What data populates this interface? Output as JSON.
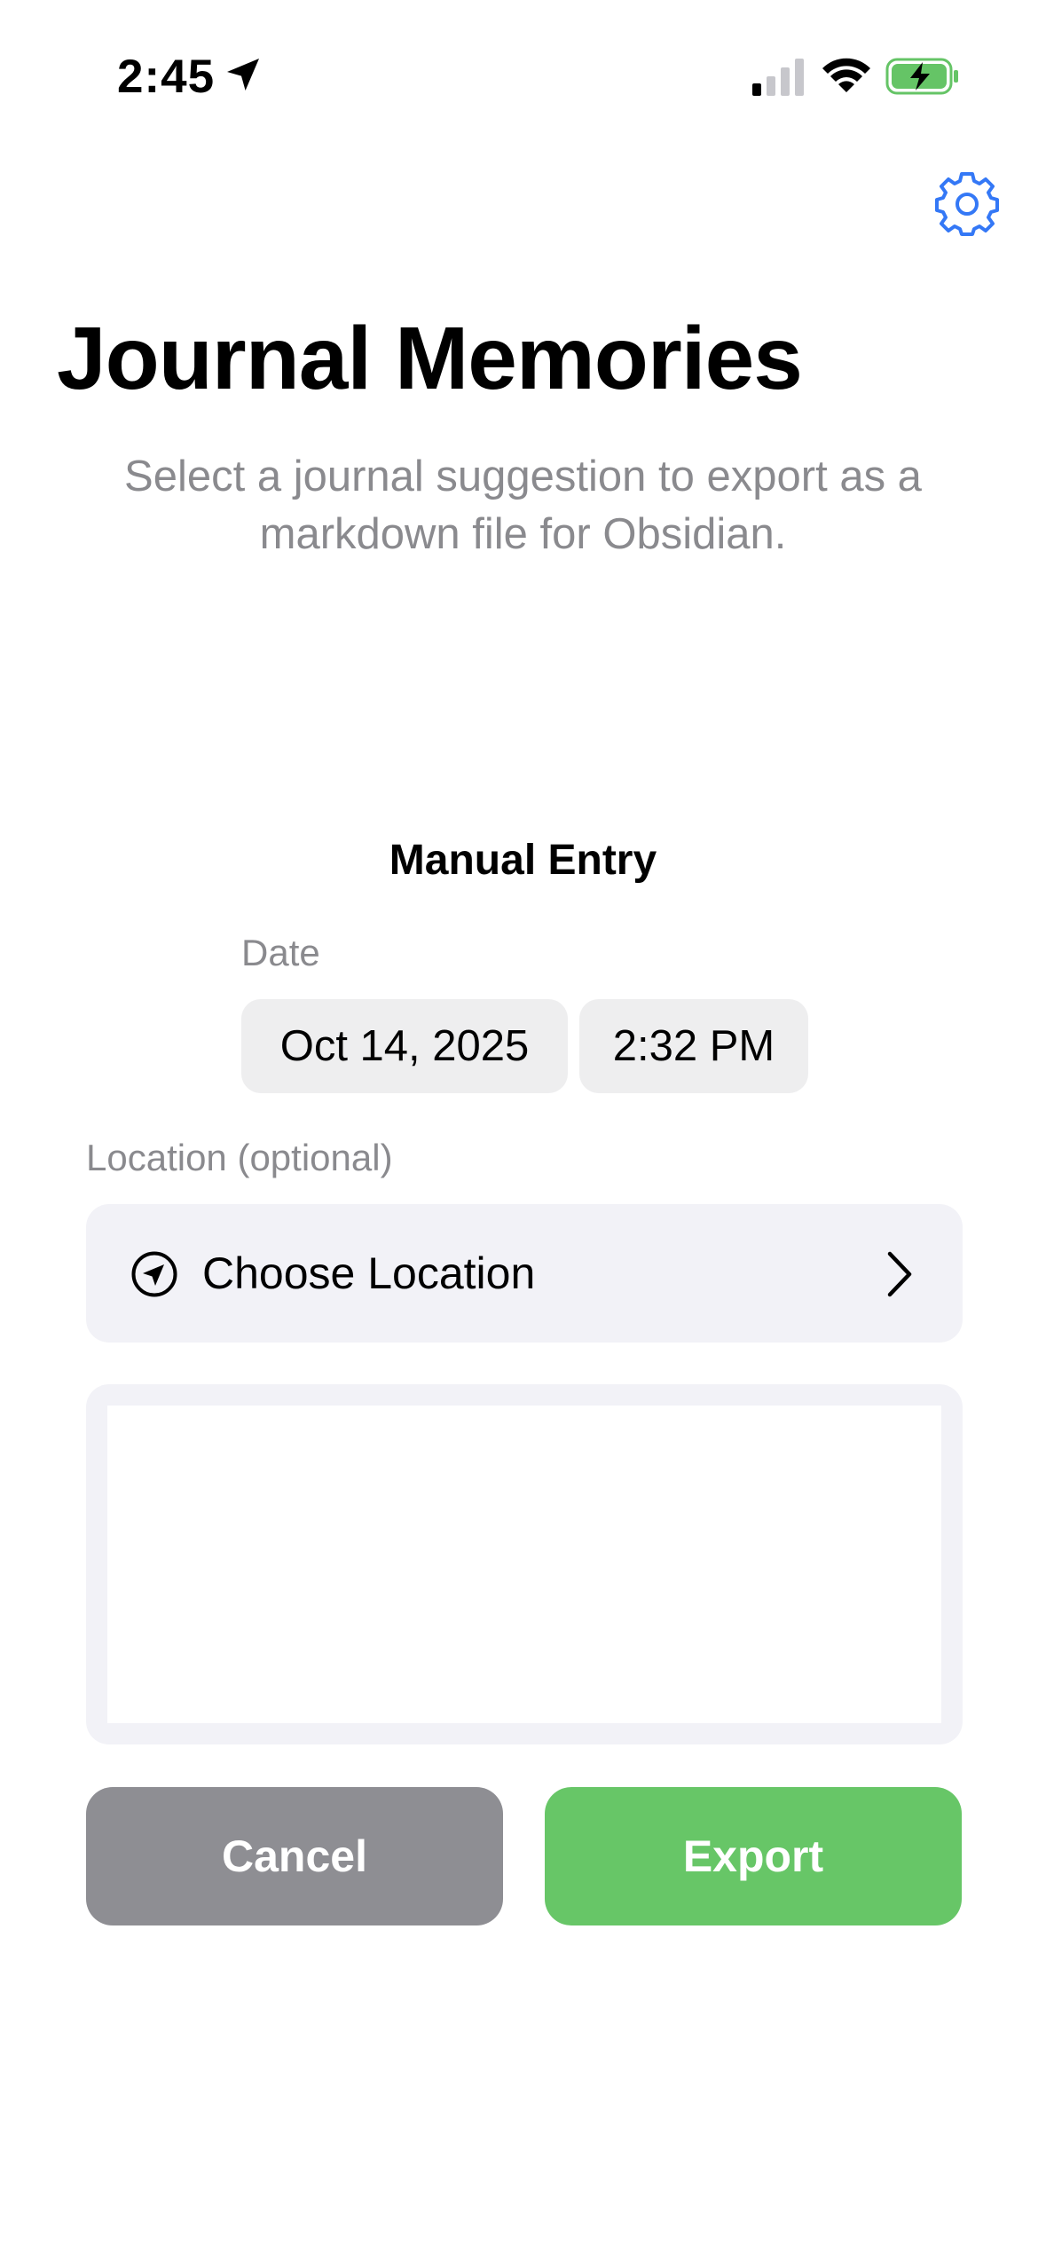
{
  "status_bar": {
    "time": "2:45"
  },
  "header": {
    "title": "Journal Memories",
    "subtitle": "Select a journal suggestion to export as a markdown file for Obsidian."
  },
  "manual_entry": {
    "heading": "Manual Entry",
    "date_label": "Date",
    "date_value": "Oct 14, 2025",
    "time_value": "2:32 PM",
    "location_label": "Location (optional)",
    "location_button": "Choose Location",
    "text_value": ""
  },
  "actions": {
    "cancel_label": "Cancel",
    "export_label": "Export"
  },
  "colors": {
    "accent": "#3478f6",
    "export_green": "#67c667",
    "cancel_gray": "#8e8e93",
    "battery_green": "#65c466"
  },
  "icons": {
    "status_location": "location-arrow-icon",
    "signal": "cellular-signal-icon",
    "wifi": "wifi-icon",
    "battery": "battery-charging-icon",
    "settings": "gear-icon",
    "location_row": "location-circle-icon",
    "disclosure": "chevron-right-icon"
  }
}
